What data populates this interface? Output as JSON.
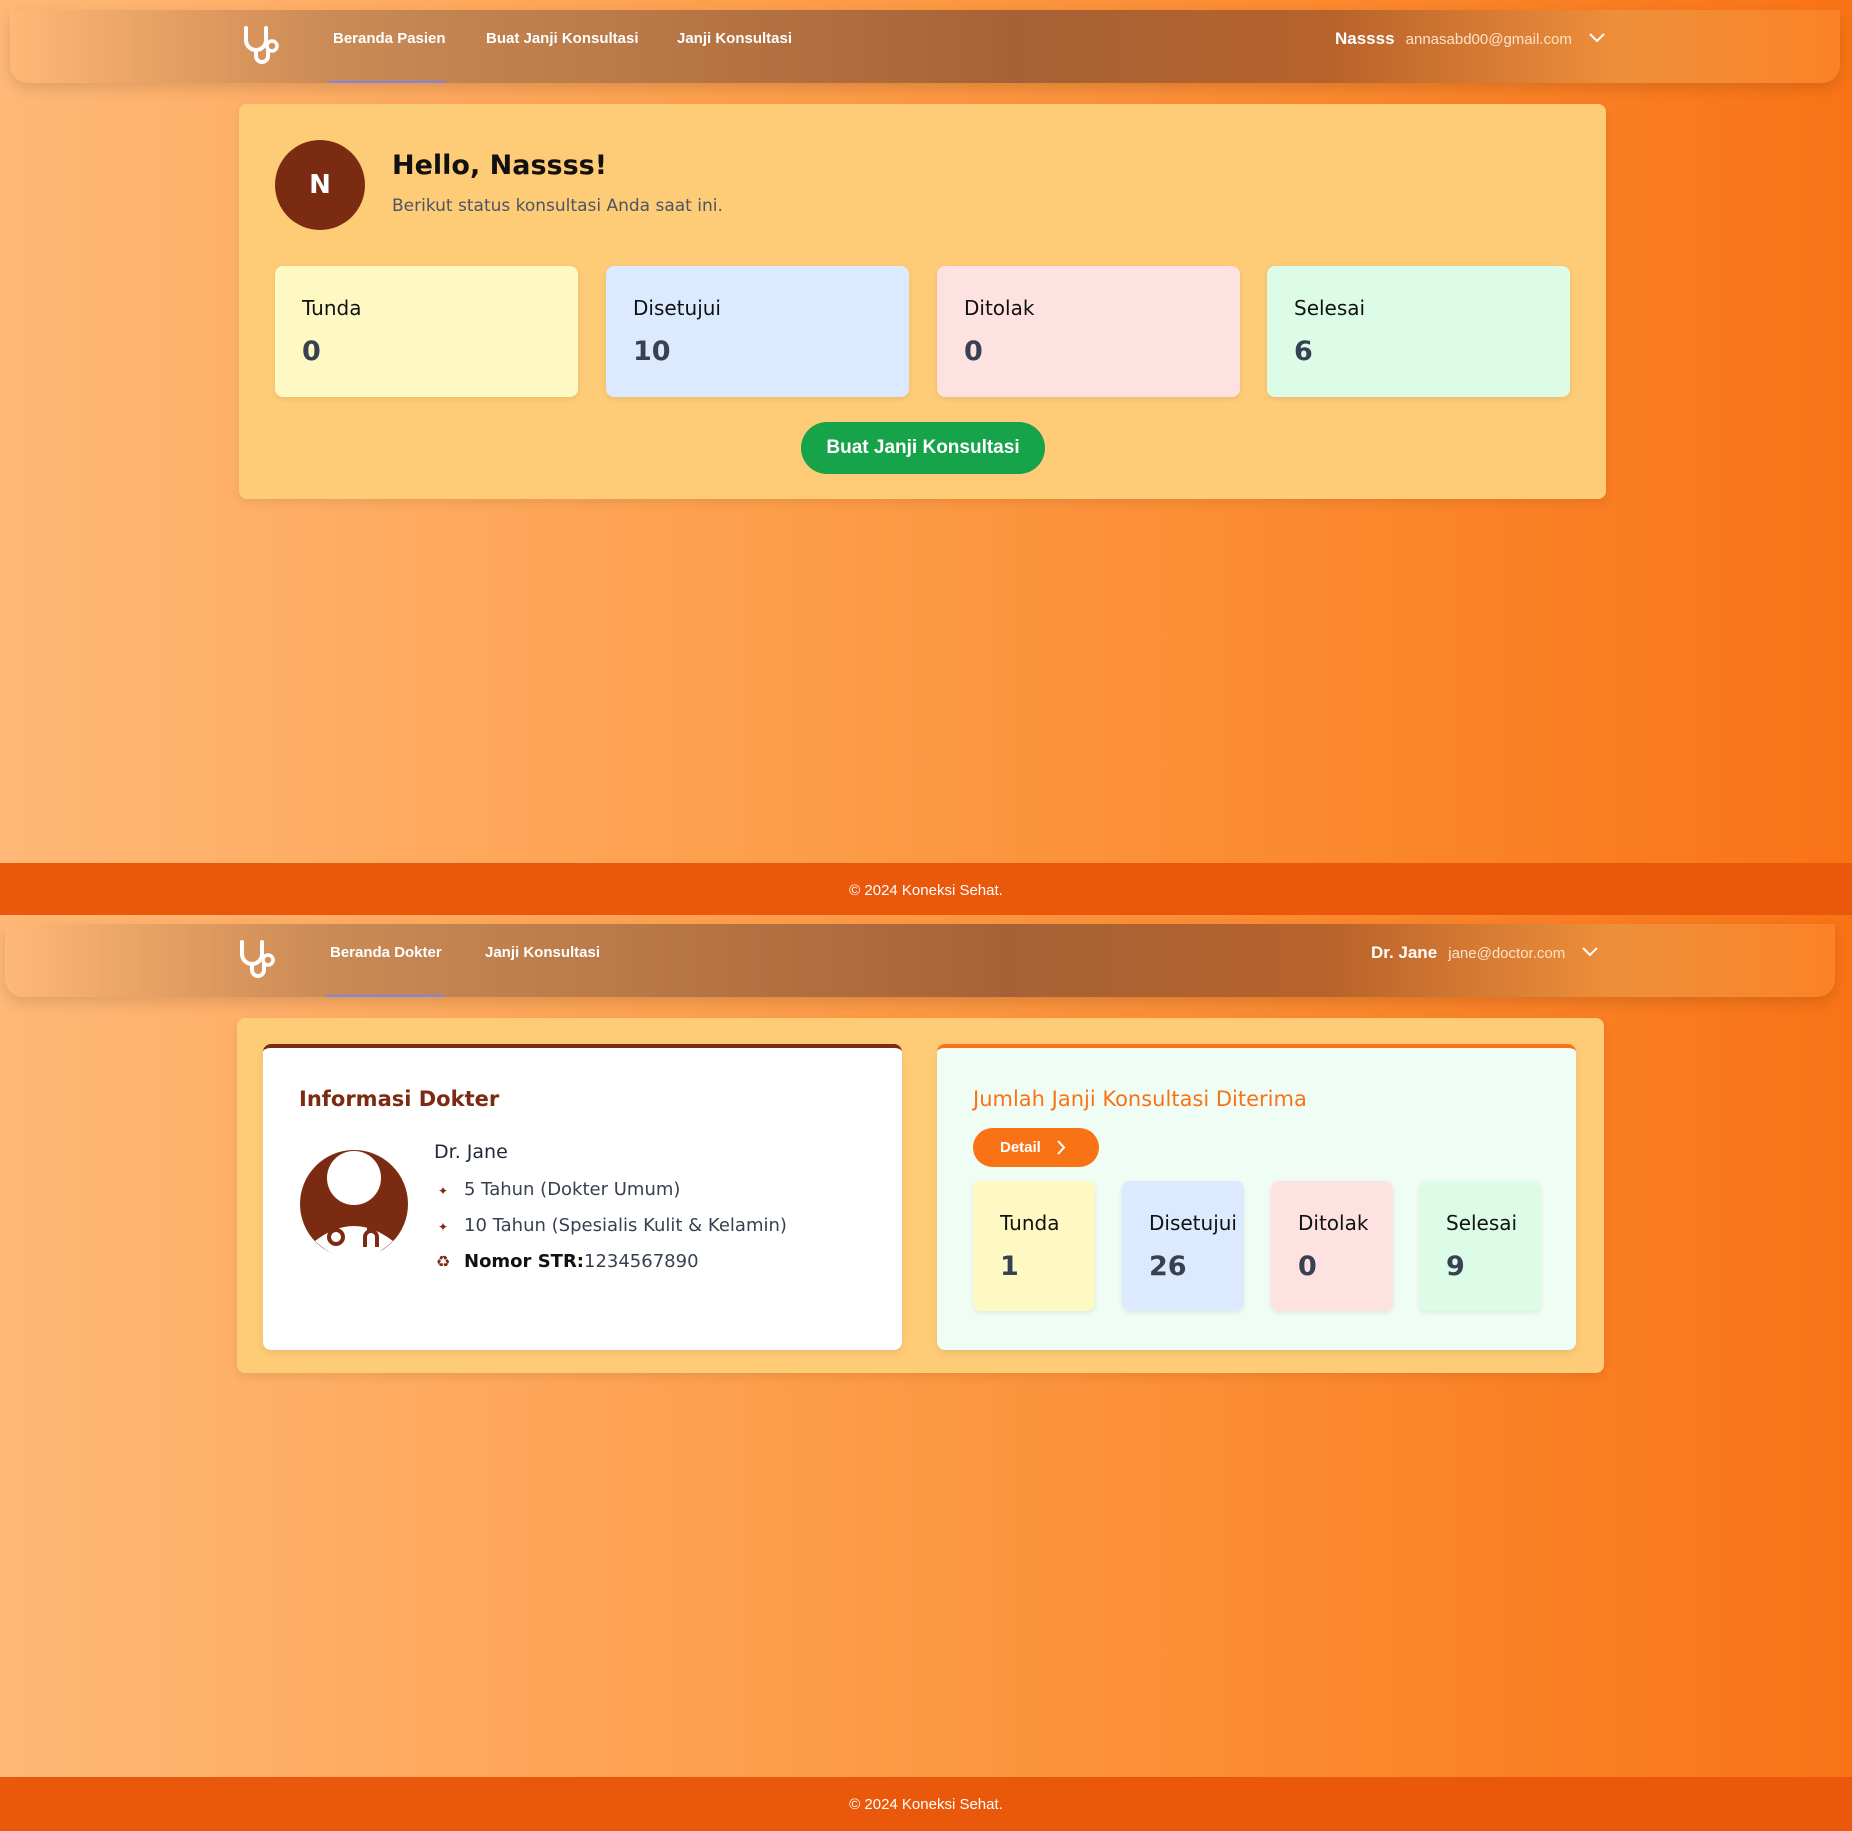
{
  "patient_view": {
    "nav": {
      "items": [
        "Beranda Pasien",
        "Buat Janji Konsultasi",
        "Janji Konsultasi"
      ],
      "active_index": 0
    },
    "user": {
      "name": "Nassss",
      "email": "annasabd00@gmail.com"
    },
    "greeting": {
      "avatar_letter": "N",
      "title": "Hello, Nassss!",
      "subtitle": "Berikut status konsultasi Anda saat ini."
    },
    "stats": [
      {
        "label": "Tunda",
        "value": "0",
        "color": "#fef9c3"
      },
      {
        "label": "Disetujui",
        "value": "10",
        "color": "#dbeafe"
      },
      {
        "label": "Ditolak",
        "value": "0",
        "color": "#fee2e2"
      },
      {
        "label": "Selesai",
        "value": "6",
        "color": "#dcfce7"
      }
    ],
    "cta_label": "Buat Janji Konsultasi",
    "footer": "© 2024 Koneksi Sehat."
  },
  "doctor_view": {
    "nav": {
      "items": [
        "Beranda Dokter",
        "Janji Konsultasi"
      ],
      "active_index": 0
    },
    "user": {
      "name": "Dr. Jane",
      "email": "jane@doctor.com"
    },
    "info_card": {
      "title": "Informasi Dokter",
      "doctor_name": "Dr. Jane",
      "experience": [
        "5 Tahun (Dokter Umum)",
        "10 Tahun (Spesialis Kulit & Kelamin)"
      ],
      "str_label": "Nomor STR:",
      "str_value": "1234567890"
    },
    "appointments_card": {
      "title": "Jumlah Janji Konsultasi Diterima",
      "detail_label": "Detail",
      "stats": [
        {
          "label": "Tunda",
          "value": "1",
          "color": "#fef9c3"
        },
        {
          "label": "Disetujui",
          "value": "26",
          "color": "#dbeafe"
        },
        {
          "label": "Ditolak",
          "value": "0",
          "color": "#fee2e2"
        },
        {
          "label": "Selesai",
          "value": "9",
          "color": "#dcfce7"
        }
      ]
    },
    "footer": "© 2024 Koneksi Sehat."
  },
  "colors": {
    "accent_brown": "#7b2b12",
    "accent_orange": "#f97316",
    "button_green": "#16a34a",
    "panel": "#fecb77",
    "footer": "#ea580c",
    "nav_active_underline": "#7c86e8"
  },
  "icons": [
    "stethoscope-icon",
    "chevron-down-icon",
    "chevron-right-icon",
    "doctor-avatar-icon",
    "experience-icon",
    "license-icon"
  ]
}
